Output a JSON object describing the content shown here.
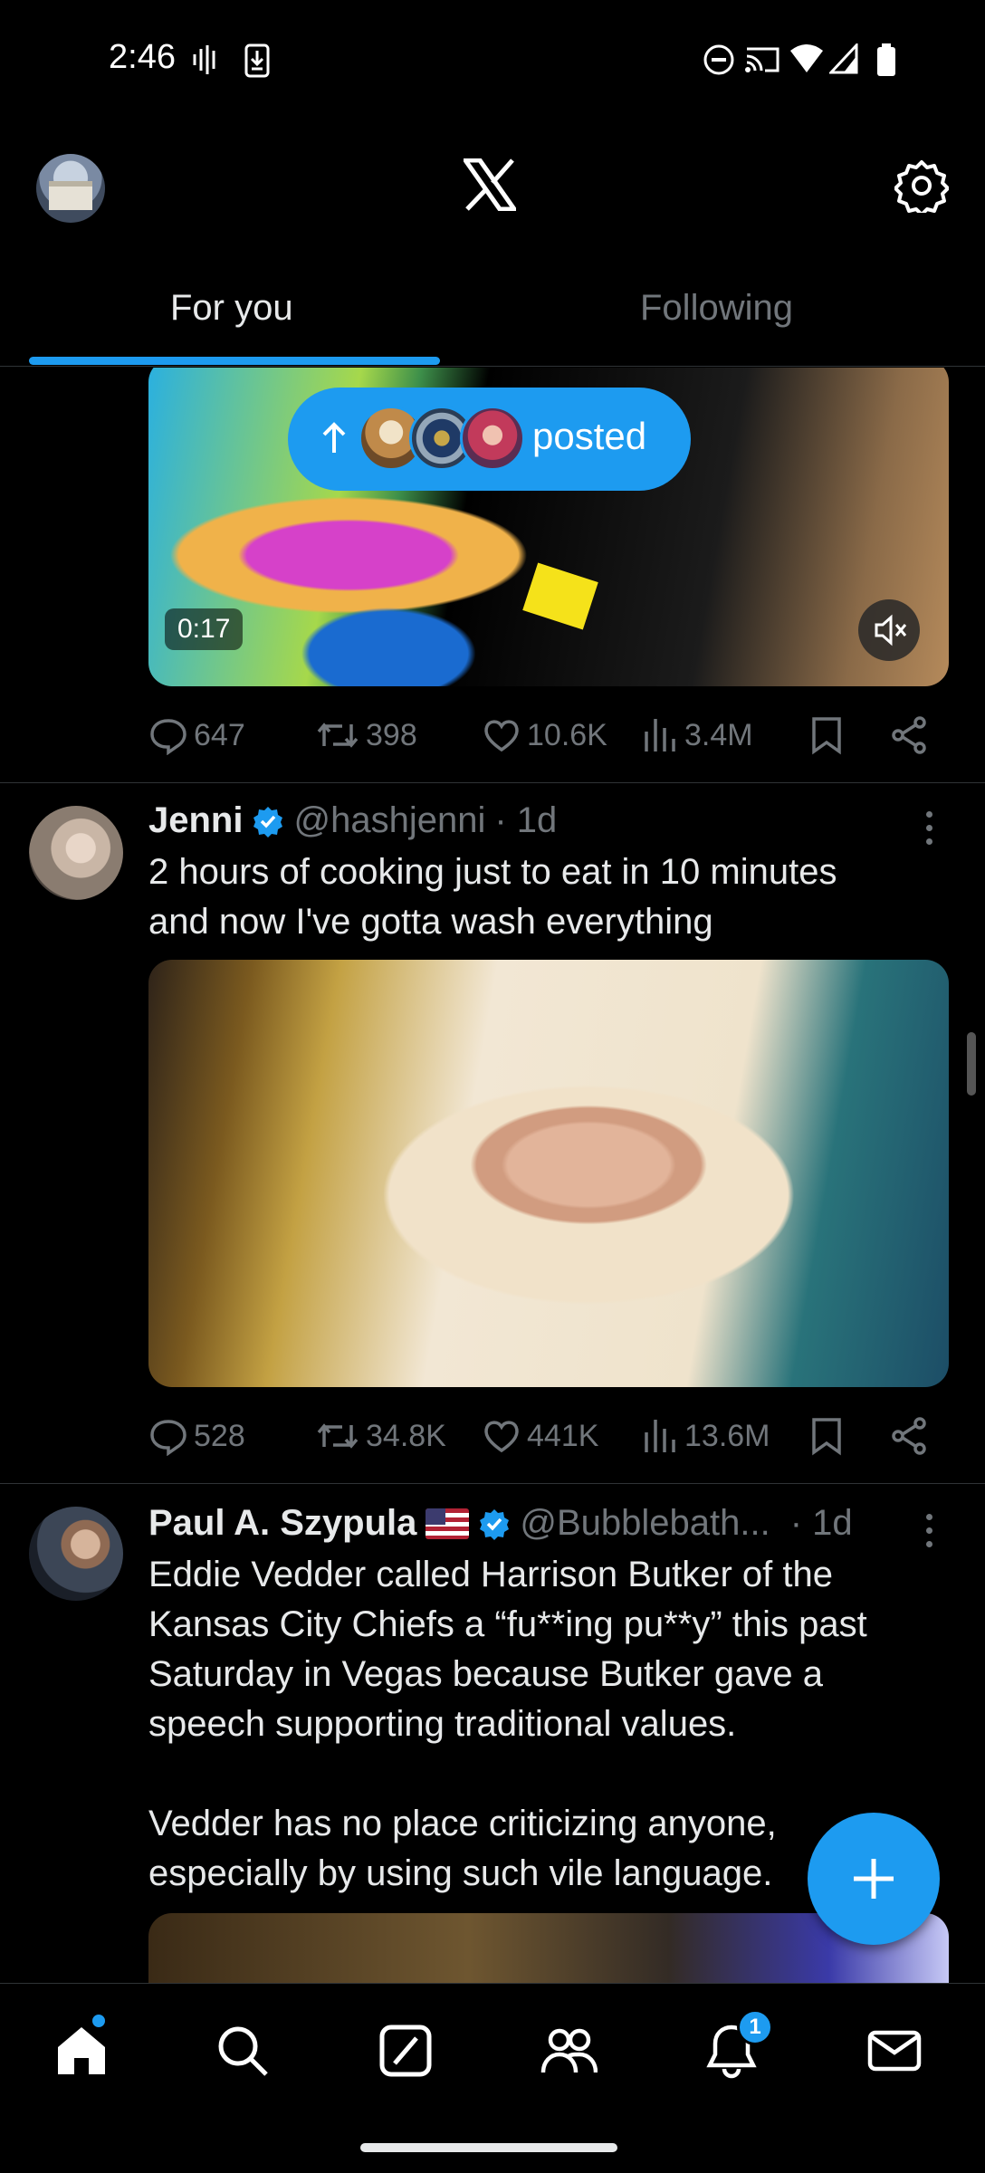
{
  "status_bar": {
    "time": "2:46"
  },
  "header": {
    "tabs": [
      {
        "label": "For you",
        "active": true
      },
      {
        "label": "Following",
        "active": false
      }
    ]
  },
  "new_posts_pill": {
    "label": "posted"
  },
  "posts": [
    {
      "video_duration": "0:17",
      "replies": "647",
      "reposts": "398",
      "likes": "10.6K",
      "views": "3.4M"
    },
    {
      "name": "Jenni",
      "handle": "@hashjenni",
      "time": "· 1d",
      "text": "2 hours of cooking just to eat in 10 minutes\nand now I've gotta wash everything",
      "replies": "528",
      "reposts": "34.8K",
      "likes": "441K",
      "views": "13.6M"
    },
    {
      "name": "Paul A. Szypula",
      "handle": "@Bubblebath...",
      "time": "· 1d",
      "text": "Eddie Vedder called Harrison Butker of the\nKansas City Chiefs a “fu**ing pu**y” this past\nSaturday in Vegas because Butker gave a\nspeech supporting traditional values.\n\nVedder has no place criticizing anyone,\nespecially by using such vile language."
    }
  ],
  "bottom_nav": {
    "notifications_badge": "1",
    "items": [
      "home-icon",
      "search-icon",
      "grok-icon",
      "communities-icon",
      "notifications-icon",
      "messages-icon"
    ]
  },
  "colors": {
    "accent": "#1d9bf0",
    "background": "#000000",
    "text": "#e7e9ea",
    "muted": "#71767b",
    "divider": "#2f3336"
  }
}
